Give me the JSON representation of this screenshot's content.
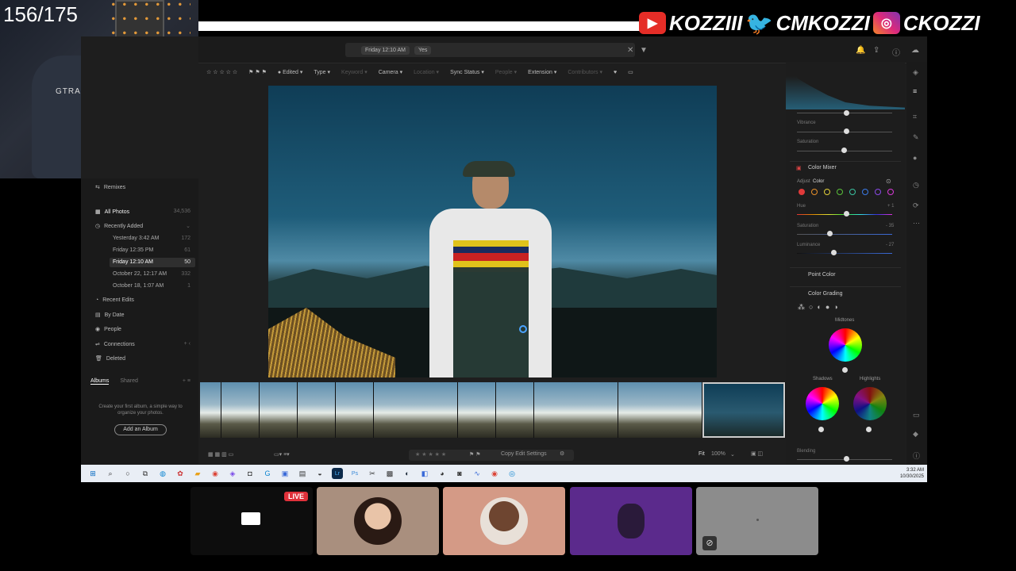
{
  "overlay": {
    "counter": "156/175",
    "socials": [
      {
        "icon": "youtube-icon",
        "handle": "KOZZIII"
      },
      {
        "icon": "twitter-icon",
        "handle": "CMKOZZI"
      },
      {
        "icon": "instagram-icon",
        "handle": "CKOZZI"
      }
    ],
    "webcam": {
      "chair_brand": "GTRACING"
    }
  },
  "app": {
    "search_chips": [
      "Friday 12:10 AM",
      "Yes"
    ],
    "filter_bar": {
      "edited": "Edited",
      "type": "Type",
      "keyword": "Keyword",
      "camera": "Camera",
      "location": "Location",
      "sync_status": "Sync Status",
      "people": "People",
      "extension": "Extension",
      "contributors": "Contributors"
    },
    "left_panel": {
      "remixes": "Remixes",
      "all_photos": "All Photos",
      "all_photos_count": "34,536",
      "recently_added": "Recently Added",
      "recent_items": [
        {
          "label": "Yesterday 3:42 AM",
          "count": "172"
        },
        {
          "label": "Friday 12:35 PM",
          "count": "61"
        },
        {
          "label": "Friday 12:10 AM",
          "count": "50"
        },
        {
          "label": "October 22, 12:17 AM",
          "count": "332"
        },
        {
          "label": "October 18, 1:07 AM",
          "count": "1"
        }
      ],
      "recent_edits": "Recent Edits",
      "by_date": "By Date",
      "people": "People",
      "connections": "Connections",
      "deleted": "Deleted",
      "albums_tab": "Albums",
      "shared_tab": "Shared",
      "empty_albums_text": "Create your first album, a simple way to organize your photos.",
      "add_album_button": "Add an Album"
    },
    "bottom_bar": {
      "copy_edit_settings": "Copy Edit Settings",
      "fit": "Fit",
      "zoom": "100%"
    },
    "right_panel": {
      "vibrance": "Vibrance",
      "saturation": "Saturation",
      "color_mixer": "Color Mixer",
      "adjust_label": "Adjust",
      "adjust_value": "Color",
      "hue": "Hue",
      "hue_value": "+ 1",
      "mixer_saturation": "Saturation",
      "mixer_saturation_value": "- 35",
      "luminance": "Luminance",
      "luminance_value": "- 27",
      "point_color": "Point Color",
      "color_grading": "Color Grading",
      "midtones": "Midtones",
      "shadows": "Shadows",
      "highlights": "Highlights",
      "blending": "Blending",
      "mixer_colors": [
        "#e03a3a",
        "#e8902a",
        "#e4d23a",
        "#5ac23a",
        "#3ac2a0",
        "#3a7ae8",
        "#8a4ae8",
        "#d83ad8"
      ]
    }
  },
  "taskbar": {
    "time": "3:32 AM",
    "date": "10/30/2025"
  },
  "participants": {
    "live_badge": "LIVE"
  },
  "colors": {
    "accent_live": "#e0313a",
    "tile_tan": "#a98f7e",
    "tile_peach": "#d49a86",
    "tile_purple": "#5b2a8c",
    "tile_gray": "#8c8c8c"
  }
}
